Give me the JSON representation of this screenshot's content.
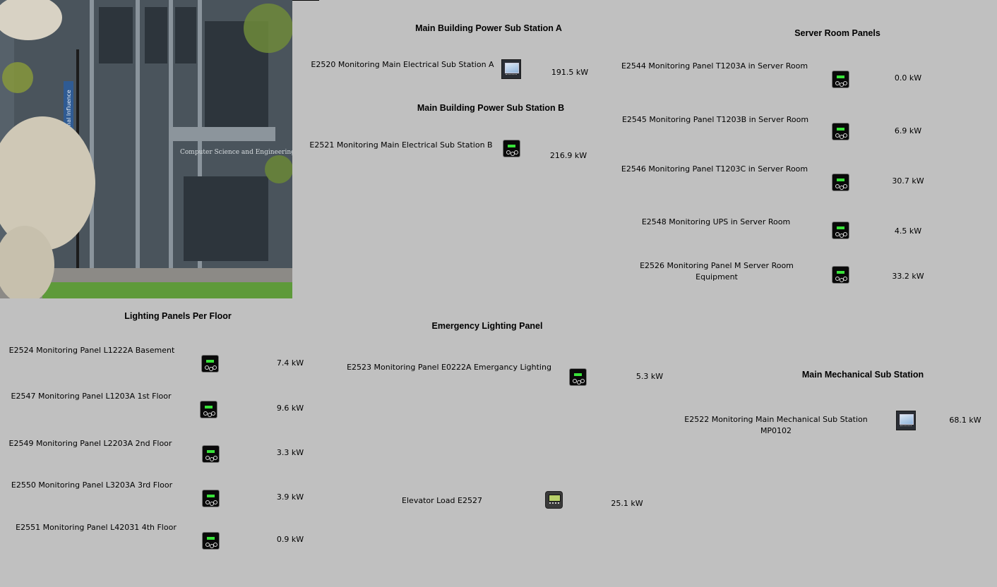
{
  "colors": {
    "background": "#c0c0c0",
    "meter_screen": "#39e23a"
  },
  "photo": {
    "sign_text": "Computer Science and Engineering",
    "banner_text": "National Influence"
  },
  "sections": {
    "sub_station_a": "Main Building Power Sub Station A",
    "sub_station_b": "Main Building Power Sub Station B",
    "server_room": "Server Room Panels",
    "lighting": "Lighting Panels Per Floor",
    "emergency": "Emergency Lighting Panel",
    "mechanical": "Main Mechanical Sub Station"
  },
  "meters": {
    "e2520": {
      "label": "E2520 Monitoring Main Electrical Sub Station A",
      "value": "191.5 kW",
      "icon": "display-meter-icon"
    },
    "e2521": {
      "label": "E2521 Monitoring Main Electrical Sub Station B",
      "value": "216.9 kW",
      "icon": "power-meter-icon"
    },
    "e2544": {
      "label": "E2544 Monitoring Panel T1203A in Server Room",
      "value": "0.0 kW",
      "icon": "power-meter-icon"
    },
    "e2545": {
      "label": "E2545 Monitoring Panel T1203B in Server Room",
      "value": "6.9 kW",
      "icon": "power-meter-icon"
    },
    "e2546": {
      "label": "E2546 Monitoring Panel T1203C in Server Room",
      "value": "30.7 kW",
      "icon": "power-meter-icon"
    },
    "e2548": {
      "label": "E2548 Monitoring UPS in Server Room",
      "value": "4.5 kW",
      "icon": "power-meter-icon"
    },
    "e2526": {
      "label": "E2526 Monitoring Panel M Server Room Equipment",
      "value": "33.2 kW",
      "icon": "power-meter-icon"
    },
    "e2524": {
      "label": "E2524 Monitoring Panel L1222A Basement",
      "value": "7.4 kW",
      "icon": "power-meter-icon"
    },
    "e2547": {
      "label": "E2547 Monitoring Panel L1203A 1st Floor",
      "value": "9.6 kW",
      "icon": "power-meter-icon"
    },
    "e2549": {
      "label": "E2549 Monitoring Panel L2203A 2nd Floor",
      "value": "3.3 kW",
      "icon": "power-meter-icon"
    },
    "e2550": {
      "label": "E2550 Monitoring Panel L3203A 3rd Floor",
      "value": "3.9 kW",
      "icon": "power-meter-icon"
    },
    "e2551": {
      "label": "E2551 Monitoring Panel L42031 4th Floor",
      "value": "0.9 kW",
      "icon": "power-meter-icon"
    },
    "e2523": {
      "label": "E2523 Monitoring Panel E0222A Emergancy Lighting",
      "value": "5.3 kW",
      "icon": "power-meter-icon"
    },
    "e2522": {
      "label": "E2522 Monitoring Main Mechanical Sub Station MP0102",
      "value": "68.1 kW",
      "icon": "display-meter-icon"
    },
    "e2527": {
      "label": "Elevator Load E2527",
      "value": "25.1 kW",
      "icon": "elevator-meter-icon"
    }
  }
}
